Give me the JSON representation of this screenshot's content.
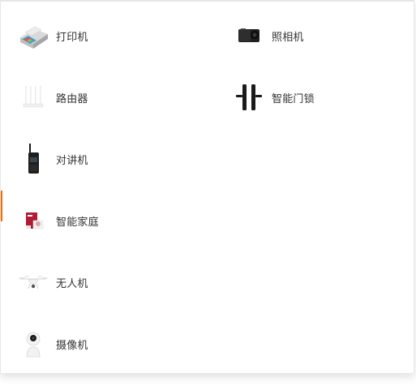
{
  "accent_color": "#ff6700",
  "menu": {
    "items": [
      {
        "label": "打印机",
        "icon": "printer-icon"
      },
      {
        "label": "照相机",
        "icon": "camera-icon"
      },
      {
        "label": "路由器",
        "icon": "router-icon"
      },
      {
        "label": "智能门锁",
        "icon": "door-lock-icon"
      },
      {
        "label": "对讲机",
        "icon": "walkie-talkie-icon"
      },
      {
        "label": "智能家庭",
        "icon": "smart-home-icon"
      },
      {
        "label": "无人机",
        "icon": "drone-icon"
      },
      {
        "label": "摄像机",
        "icon": "security-camera-icon"
      }
    ]
  }
}
